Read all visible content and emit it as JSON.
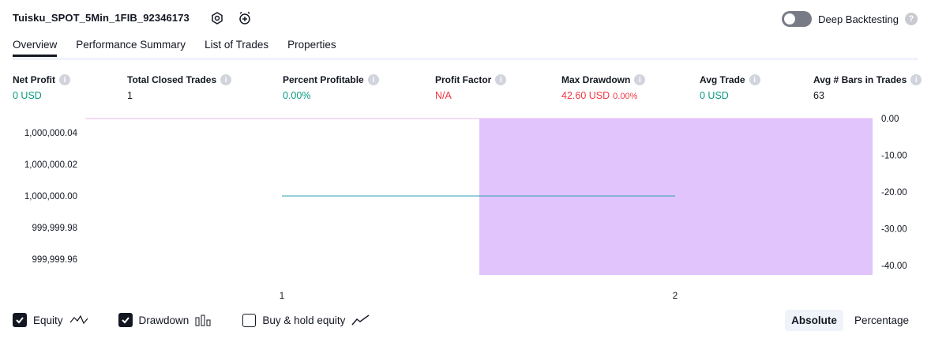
{
  "header": {
    "strategy_name": "Tuisku_SPOT_5Min_1FIB_92346173",
    "settings_icon": "gear-icon",
    "alert_icon": "add-alert-icon",
    "deep_backtesting_label": "Deep Backtesting",
    "deep_backtesting_on": false
  },
  "tabs": [
    {
      "label": "Overview",
      "active": true
    },
    {
      "label": "Performance Summary",
      "active": false
    },
    {
      "label": "List of Trades",
      "active": false
    },
    {
      "label": "Properties",
      "active": false
    }
  ],
  "metrics": {
    "net_profit": {
      "label": "Net Profit",
      "value": "0 USD"
    },
    "total_closed_trades": {
      "label": "Total Closed Trades",
      "value": "1"
    },
    "percent_profitable": {
      "label": "Percent Profitable",
      "value": "0.00%"
    },
    "profit_factor": {
      "label": "Profit Factor",
      "value": "N/A"
    },
    "max_drawdown": {
      "label": "Max Drawdown",
      "value": "42.60 USD",
      "percent": "0.00%"
    },
    "avg_trade": {
      "label": "Avg Trade",
      "value": "0 USD"
    },
    "avg_bars": {
      "label": "Avg # Bars in Trades",
      "value": "63"
    }
  },
  "colors": {
    "green": "#089981",
    "red": "#f23645",
    "equity_line": "#2b9fb0",
    "drawdown_fill": "#e1c4fc"
  },
  "chart_data": {
    "type": "line",
    "x_ticks": [
      "1",
      "2"
    ],
    "left_axis": {
      "ticks": [
        "1,000,000.04",
        "1,000,000.02",
        "1,000,000.00",
        "999,999.98",
        "999,999.96"
      ],
      "values": [
        1000000.04,
        1000000.02,
        1000000.0,
        999999.98,
        999999.96
      ]
    },
    "right_axis": {
      "ticks": [
        "0.00",
        "-10.00",
        "-20.00",
        "-30.00",
        "-40.00"
      ],
      "values": [
        0,
        -10,
        -20,
        -30,
        -40
      ]
    },
    "series": [
      {
        "name": "Equity",
        "x": [
          1,
          2
        ],
        "values": [
          1000000.0,
          1000000.0
        ]
      },
      {
        "name": "Drawdown",
        "x": [
          2
        ],
        "values": [
          -42.6
        ]
      }
    ],
    "legend_position": "bottom"
  },
  "footer": {
    "equity_label": "Equity",
    "drawdown_label": "Drawdown",
    "buyhold_label": "Buy & hold equity",
    "equity_checked": true,
    "drawdown_checked": true,
    "buyhold_checked": false,
    "absolute_label": "Absolute",
    "percentage_label": "Percentage",
    "selected_mode": "Absolute"
  }
}
